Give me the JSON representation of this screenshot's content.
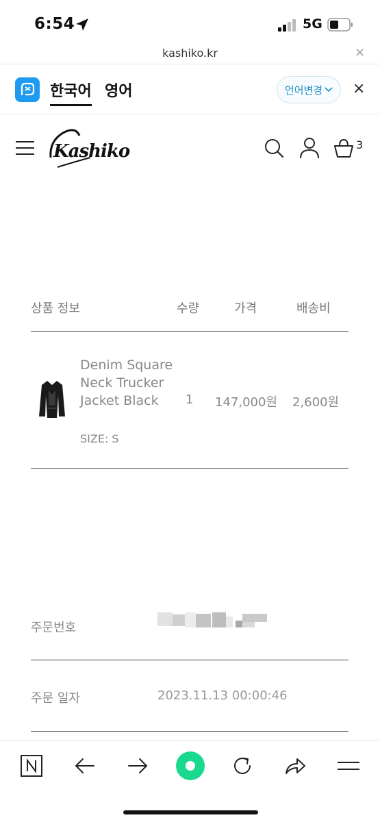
{
  "status_bar": {
    "time": "6:54",
    "network": "5G"
  },
  "browser": {
    "url": "kashiko.kr",
    "close_glyph": "×"
  },
  "translate": {
    "tab_active": "한국어",
    "tab_other": "영어",
    "change_label": "언어변경",
    "close_glyph": "×"
  },
  "header": {
    "logo_text": "Kashiko",
    "cart_count": "3"
  },
  "table": {
    "headers": {
      "info": "상품 정보",
      "qty": "수량",
      "price": "가격",
      "shipping": "배송비"
    },
    "items": [
      {
        "name": "Denim Square Neck Trucker Jacket Black",
        "size": "SIZE: S",
        "qty": "1",
        "price": "147,000원",
        "shipping": "2,600원"
      }
    ]
  },
  "order": {
    "number_label": "주문번호",
    "date_label": "주문 일자",
    "date_value": "2023.11.13 00:00:46"
  },
  "colors": {
    "accent_blue": "#1b8fc4",
    "papago_blue": "#1e9bf0",
    "center_green": "#19d98f"
  }
}
